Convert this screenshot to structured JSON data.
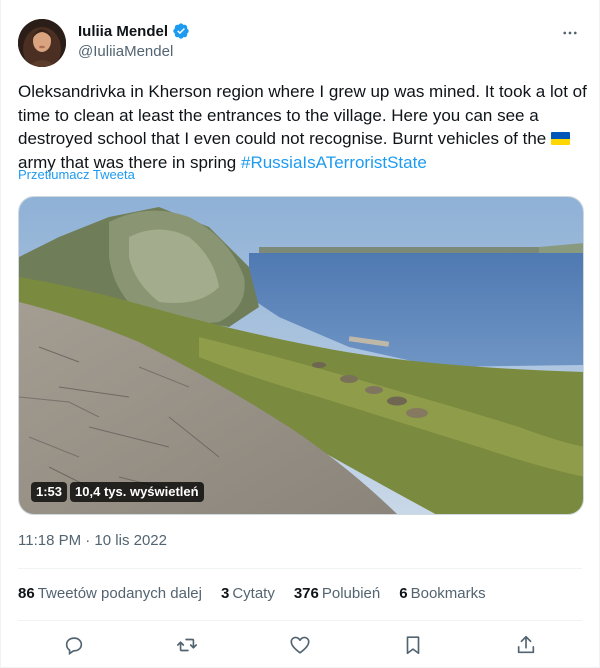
{
  "author": {
    "display_name": "Iuliia Mendel",
    "handle": "@IuliiaMendel",
    "verified": true,
    "avatar_icon": "avatar-photo"
  },
  "tweet": {
    "text_before_flag": "Oleksandrivka in Kherson region where I grew up was mined. It took a lot of time to clean at least the entrances to the village. Here you can see a destroyed school that I even could not recognise. Burnt vehicles of the ",
    "flag_icon": "ukraine-flag-icon",
    "text_after_flag": "army that was there in spring ",
    "hashtag": "#RussiaIsATerroristState",
    "translate_label": "Przetłumacz Tweeta"
  },
  "media": {
    "duration": "1:53",
    "views": "10,4 tys. wyświetleń"
  },
  "timestamp": "11:18 PM · 10 lis 2022",
  "stats": {
    "retweets": {
      "count": "86",
      "label": "Tweetów podanych dalej"
    },
    "quotes": {
      "count": "3",
      "label": "Cytaty"
    },
    "likes": {
      "count": "376",
      "label": "Polubień"
    },
    "bookmarks": {
      "count": "6",
      "label": "Bookmarks"
    }
  },
  "actions": [
    "reply-icon",
    "retweet-icon",
    "like-icon",
    "bookmark-icon",
    "share-icon"
  ],
  "colors": {
    "accent": "#1d9bf0",
    "text": "#0f1419",
    "secondary": "#536471",
    "border": "#eff3f4"
  }
}
